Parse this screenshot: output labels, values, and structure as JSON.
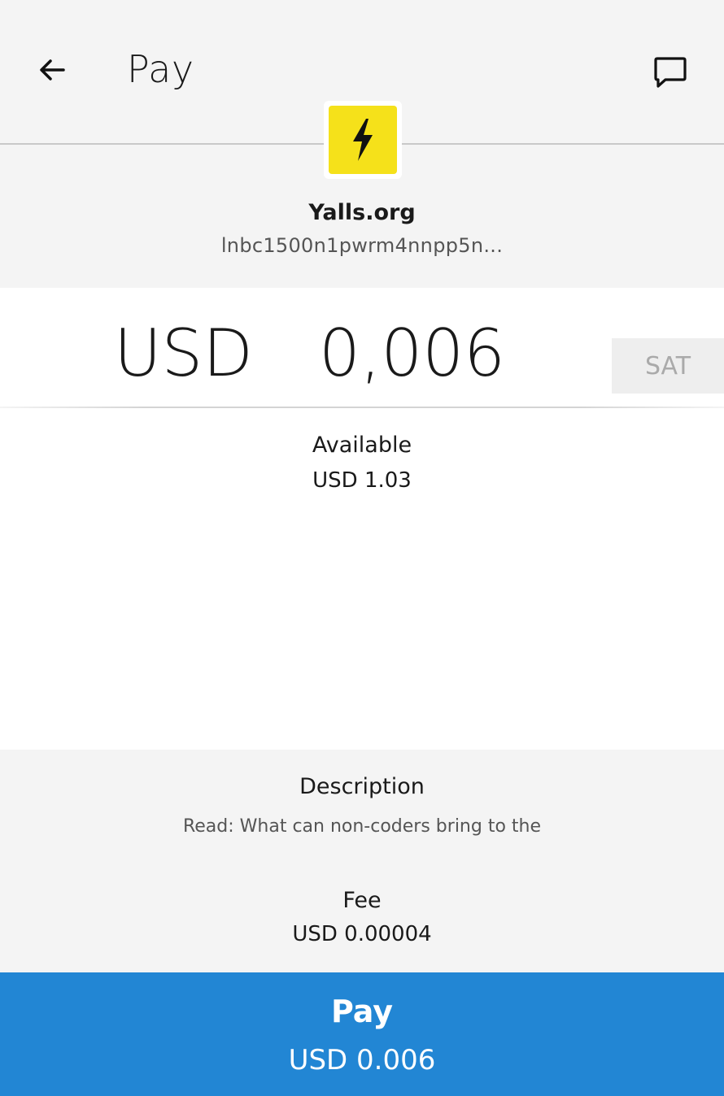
{
  "header": {
    "title": "Pay",
    "back_icon": "arrow-left-icon",
    "chat_icon": "message-icon"
  },
  "merchant": {
    "logo_icon": "lightning-bolt-icon",
    "logo_color": "#f5e11a",
    "name": "Yalls.org",
    "invoice": "lnbc1500n1pwrm4nnpp5n..."
  },
  "amount": {
    "currency": "USD",
    "value": "0,006",
    "unit_toggle": "SAT"
  },
  "available": {
    "label": "Available",
    "value": "USD 1.03"
  },
  "details": {
    "description_label": "Description",
    "description_value": "Read: What can non-coders bring to the",
    "fee_label": "Fee",
    "fee_value": "USD 0.00004"
  },
  "pay_button": {
    "label": "Pay",
    "amount": "USD 0.006",
    "color": "#2286d4"
  }
}
